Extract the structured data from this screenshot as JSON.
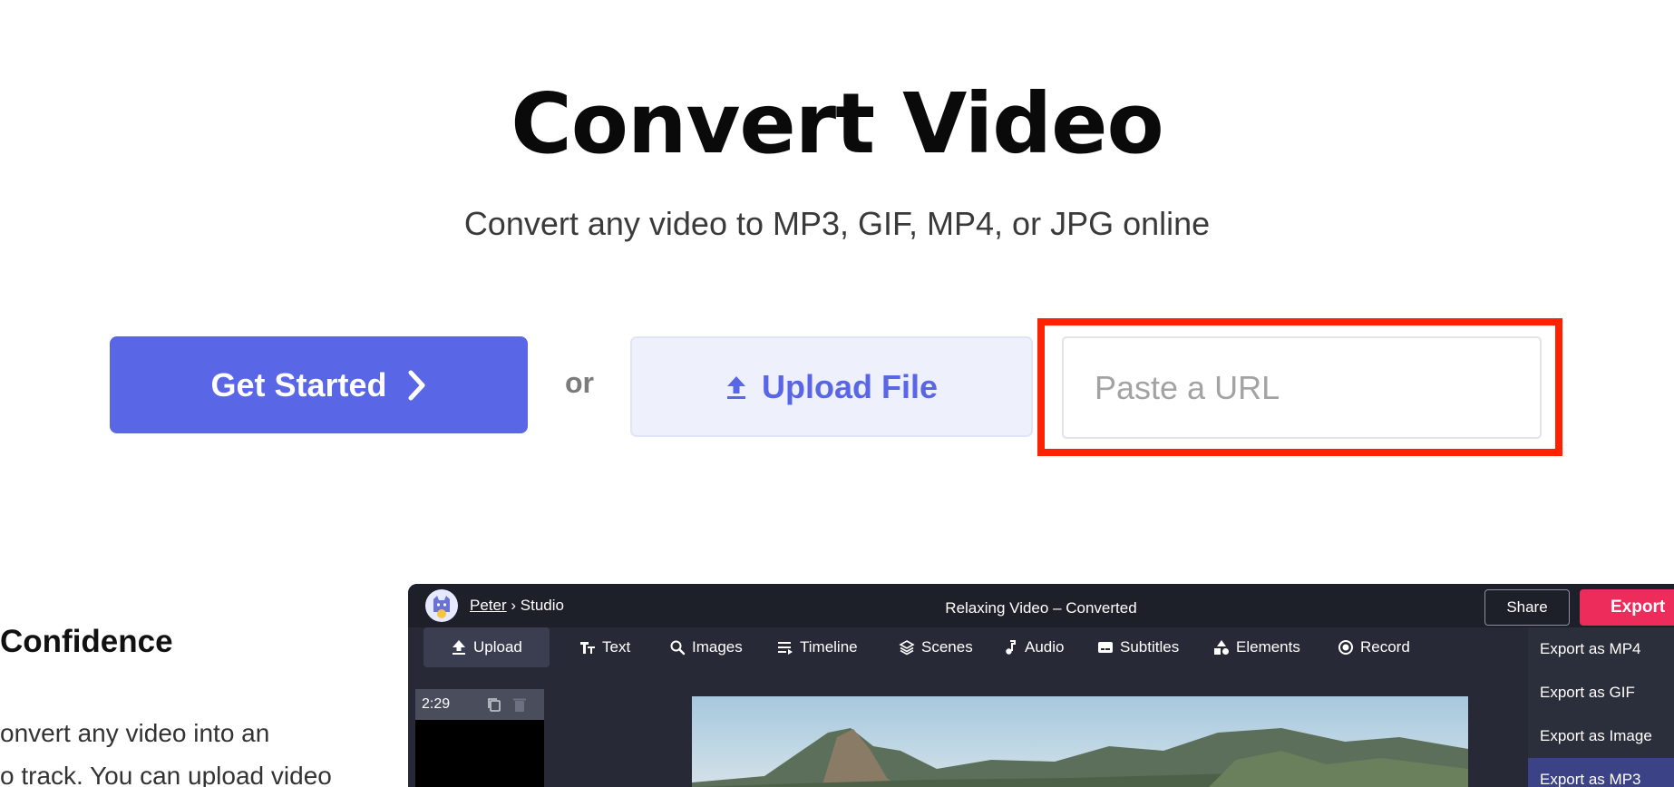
{
  "hero": {
    "title": "Convert Video",
    "subtitle": "Convert any video to MP3, GIF, MP4, or JPG online"
  },
  "cta": {
    "get_started_label": "Get Started",
    "or_label": "or",
    "upload_label": "Upload File",
    "url_placeholder": "Paste a URL",
    "url_value": ""
  },
  "feature": {
    "heading": "Confidence",
    "text_line1": "onvert any video into an",
    "text_line2": "o track. You can upload video"
  },
  "studio": {
    "user": "Peter",
    "separator": "›",
    "section": "Studio",
    "doc_title": "Relaxing Video – Converted",
    "share_label": "Share",
    "export_label": "Export",
    "toolbar": [
      {
        "label": "Upload",
        "icon": "upload-icon"
      },
      {
        "label": "Text",
        "icon": "text-icon"
      },
      {
        "label": "Images",
        "icon": "search-icon"
      },
      {
        "label": "Timeline",
        "icon": "timeline-icon"
      },
      {
        "label": "Scenes",
        "icon": "layers-icon"
      },
      {
        "label": "Audio",
        "icon": "music-note-icon"
      },
      {
        "label": "Subtitles",
        "icon": "subtitles-icon"
      },
      {
        "label": "Elements",
        "icon": "shapes-icon"
      },
      {
        "label": "Record",
        "icon": "record-icon"
      }
    ],
    "scene_duration": "2:29",
    "export_menu": [
      "Export as MP4",
      "Export as GIF",
      "Export as Image",
      "Export as MP3"
    ]
  },
  "colors": {
    "primary": "#5966e6",
    "upload_bg": "#eef0fc",
    "highlight": "#ff2200",
    "studio_bg": "#272a36",
    "export_red": "#ee2c5c"
  }
}
